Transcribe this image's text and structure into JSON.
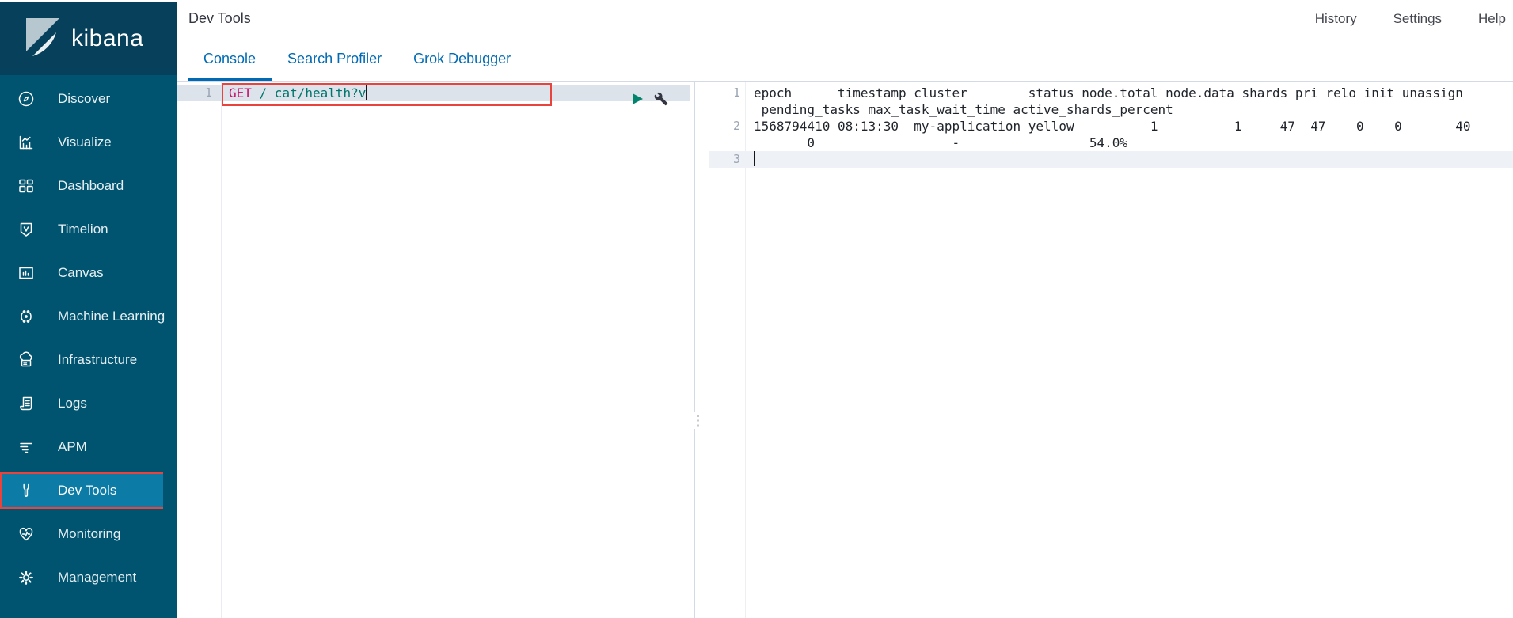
{
  "colors": {
    "sidebar_bg": "#00546F",
    "logo_bg": "#07405A",
    "selected_item_bg": "#0C7CA7",
    "annotation_red": "#E8433C",
    "tab_blue": "#006BB4",
    "border_gray": "#D3DAE6",
    "editor_active_line": "#DCE3EA",
    "output_active_line": "#EEF1F5",
    "method_color": "#C80A68",
    "url_color": "#00756B",
    "play_green": "#01836D"
  },
  "sidebar": {
    "logo_text": "kibana",
    "items": [
      {
        "label": "Discover",
        "icon": "compass-icon",
        "selected": false,
        "annotated": false
      },
      {
        "label": "Visualize",
        "icon": "bar-chart-icon",
        "selected": false,
        "annotated": false
      },
      {
        "label": "Dashboard",
        "icon": "dashboard-grid-icon",
        "selected": false,
        "annotated": false
      },
      {
        "label": "Timelion",
        "icon": "timelion-shield-icon",
        "selected": false,
        "annotated": false
      },
      {
        "label": "Canvas",
        "icon": "canvas-frame-icon",
        "selected": false,
        "annotated": false
      },
      {
        "label": "Machine Learning",
        "icon": "machine-learning-icon",
        "selected": false,
        "annotated": false
      },
      {
        "label": "Infrastructure",
        "icon": "infrastructure-cloud-icon",
        "selected": false,
        "annotated": false
      },
      {
        "label": "Logs",
        "icon": "logs-scroll-icon",
        "selected": false,
        "annotated": false
      },
      {
        "label": "APM",
        "icon": "apm-lines-icon",
        "selected": false,
        "annotated": false
      },
      {
        "label": "Dev Tools",
        "icon": "wrench-icon",
        "selected": true,
        "annotated": true
      },
      {
        "label": "Monitoring",
        "icon": "heartbeat-icon",
        "selected": false,
        "annotated": false
      },
      {
        "label": "Management",
        "icon": "gear-icon",
        "selected": false,
        "annotated": false
      }
    ]
  },
  "header": {
    "title": "Dev Tools",
    "actions": [
      {
        "label": "History"
      },
      {
        "label": "Settings"
      },
      {
        "label": "Help"
      }
    ],
    "tabs": [
      {
        "label": "Console",
        "active": true
      },
      {
        "label": "Search Profiler",
        "active": false
      },
      {
        "label": "Grok Debugger",
        "active": false
      }
    ]
  },
  "editor": {
    "lines": [
      {
        "number": "1",
        "method": "GET",
        "path": " /_cat/health?v",
        "active": true,
        "annotated": true,
        "cursor": true
      }
    ],
    "actions": [
      {
        "name": "send-request",
        "icon": "play-icon"
      },
      {
        "name": "request-options",
        "icon": "wrench-dark-icon"
      }
    ]
  },
  "output": {
    "rows": [
      {
        "number": "1",
        "text": "epoch      timestamp cluster        status node.total node.data shards pri relo init unassign",
        "active": false,
        "cursor": false
      },
      {
        "number": "",
        "text": " pending_tasks max_task_wait_time active_shards_percent",
        "active": false,
        "cursor": false
      },
      {
        "number": "2",
        "text": "1568794410 08:13:30  my-application yellow          1          1     47  47    0    0       40",
        "active": false,
        "cursor": false
      },
      {
        "number": "",
        "text": "       0                  -                 54.0%",
        "active": false,
        "cursor": false
      },
      {
        "number": "3",
        "text": "",
        "active": true,
        "cursor": true
      }
    ]
  }
}
